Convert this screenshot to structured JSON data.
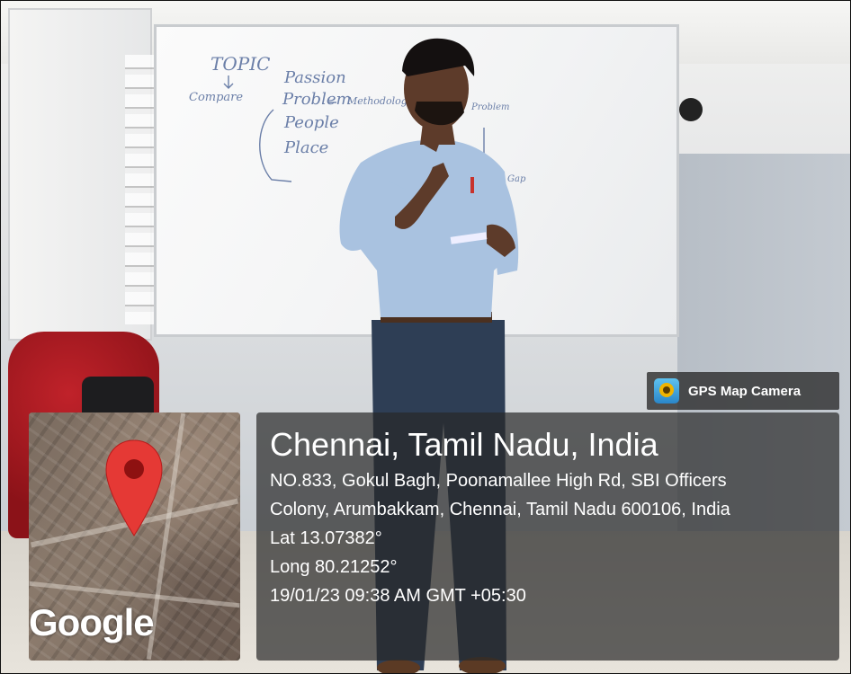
{
  "badge": {
    "text": "GPS Map Camera",
    "icon": "gps-map-camera-app-icon"
  },
  "map": {
    "attribution": "Google",
    "marker_icon": "location-pin-icon",
    "marker_color": "#e53935"
  },
  "location": {
    "title": "Chennai, Tamil Nadu, India",
    "address_line1": "NO.833, Gokul Bagh, Poonamallee High Rd, SBI Officers",
    "address_line2": "Colony, Arumbakkam, Chennai, Tamil Nadu 600106, India",
    "lat": "Lat 13.07382°",
    "long": "Long 80.21252°",
    "datetime": "19/01/23 09:38 AM GMT +05:30"
  },
  "whiteboard_text": [
    "TOPIC",
    "Compare",
    "Passion",
    "Problem",
    "People",
    "Place",
    "Methodology",
    "Problem",
    "Gap"
  ]
}
